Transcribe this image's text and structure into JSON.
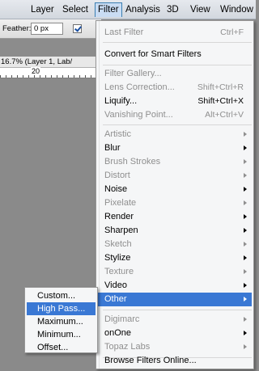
{
  "menubar": {
    "items": [
      "Layer",
      "Select",
      "Filter",
      "Analysis",
      "3D",
      "View",
      "Window"
    ],
    "active": "Filter"
  },
  "options_bar": {
    "feather_label": "Feather:",
    "feather_value": "0 px"
  },
  "document": {
    "tab_title": "16.7% (Layer 1, Lab/",
    "ruler_label": "20"
  },
  "filter_menu": {
    "last_filter": {
      "label": "Last Filter",
      "shortcut": "Ctrl+F"
    },
    "convert": {
      "label": "Convert for Smart Filters"
    },
    "filter_gallery": {
      "label": "Filter Gallery..."
    },
    "lens_correction": {
      "label": "Lens Correction...",
      "shortcut": "Shift+Ctrl+R"
    },
    "liquify": {
      "label": "Liquify...",
      "shortcut": "Shift+Ctrl+X"
    },
    "vanishing_point": {
      "label": "Vanishing Point...",
      "shortcut": "Alt+Ctrl+V"
    },
    "submenus": [
      {
        "label": "Artistic",
        "disabled": true
      },
      {
        "label": "Blur",
        "disabled": false
      },
      {
        "label": "Brush Strokes",
        "disabled": true
      },
      {
        "label": "Distort",
        "disabled": true
      },
      {
        "label": "Noise",
        "disabled": false
      },
      {
        "label": "Pixelate",
        "disabled": true
      },
      {
        "label": "Render",
        "disabled": false
      },
      {
        "label": "Sharpen",
        "disabled": false
      },
      {
        "label": "Sketch",
        "disabled": true
      },
      {
        "label": "Stylize",
        "disabled": false
      },
      {
        "label": "Texture",
        "disabled": true
      },
      {
        "label": "Video",
        "disabled": false
      },
      {
        "label": "Other",
        "disabled": false,
        "highlighted": true
      }
    ],
    "plugins": [
      {
        "label": "Digimarc",
        "disabled": true
      },
      {
        "label": "onOne",
        "disabled": false
      },
      {
        "label": "Topaz Labs",
        "disabled": true
      }
    ],
    "browse": {
      "label": "Browse Filters Online..."
    }
  },
  "other_submenu": {
    "items": [
      {
        "label": "Custom...",
        "highlighted": false
      },
      {
        "label": "High Pass...",
        "highlighted": true
      },
      {
        "label": "Maximum...",
        "highlighted": false
      },
      {
        "label": "Minimum...",
        "highlighted": false
      },
      {
        "label": "Offset...",
        "highlighted": false
      }
    ]
  },
  "colors": {
    "highlight": "#3a78d4",
    "menu_bg": "#f5f6f7",
    "disabled_text": "#8f8f8f"
  }
}
